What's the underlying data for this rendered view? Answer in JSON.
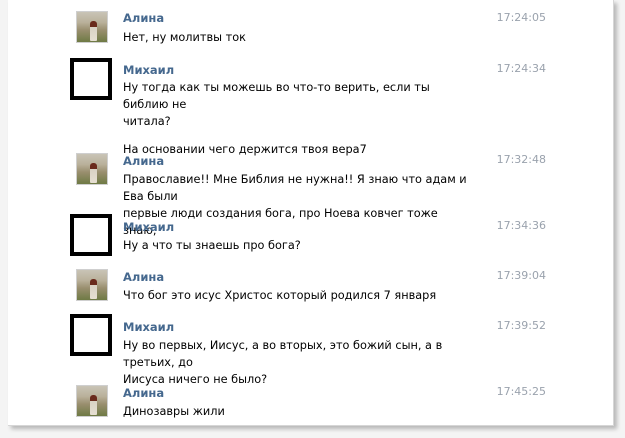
{
  "messages": [
    {
      "sender": "Алина",
      "avatar": "photo",
      "time": "17:24:05",
      "lines": [
        "Нет, ну молитвы ток"
      ]
    },
    {
      "sender": "Михаил",
      "avatar": "blank",
      "time": "17:24:34",
      "lines": [
        "Ну тогда как ты можешь во что-то верить, если ты библию не",
        "читала?"
      ],
      "extra": "На основании чего держится твоя вера7"
    },
    {
      "sender": "Алина",
      "avatar": "photo",
      "time": "17:32:48",
      "lines": [
        "Православие!! Мне Библия не нужна!! Я знаю что адам и Ева были",
        "первые люди создания бога, про Ноева ковчег тоже знаю,"
      ]
    },
    {
      "sender": "Михаил",
      "avatar": "blank",
      "time": "17:34:36",
      "lines": [
        "Ну а что ты знаешь про бога?"
      ]
    },
    {
      "sender": "Алина",
      "avatar": "photo",
      "time": "17:39:04",
      "lines": [
        "Что бог это исус Христос который родился 7 января"
      ]
    },
    {
      "sender": "Михаил",
      "avatar": "blank",
      "time": "17:39:52",
      "lines": [
        "Ну во первых, Иисус, а во вторых, это божий сын, а в третьих, до",
        "Иисуса ничего не было?"
      ]
    },
    {
      "sender": "Алина",
      "avatar": "photo",
      "time": "17:45:25",
      "lines": [
        "Динозавры жили"
      ]
    }
  ]
}
